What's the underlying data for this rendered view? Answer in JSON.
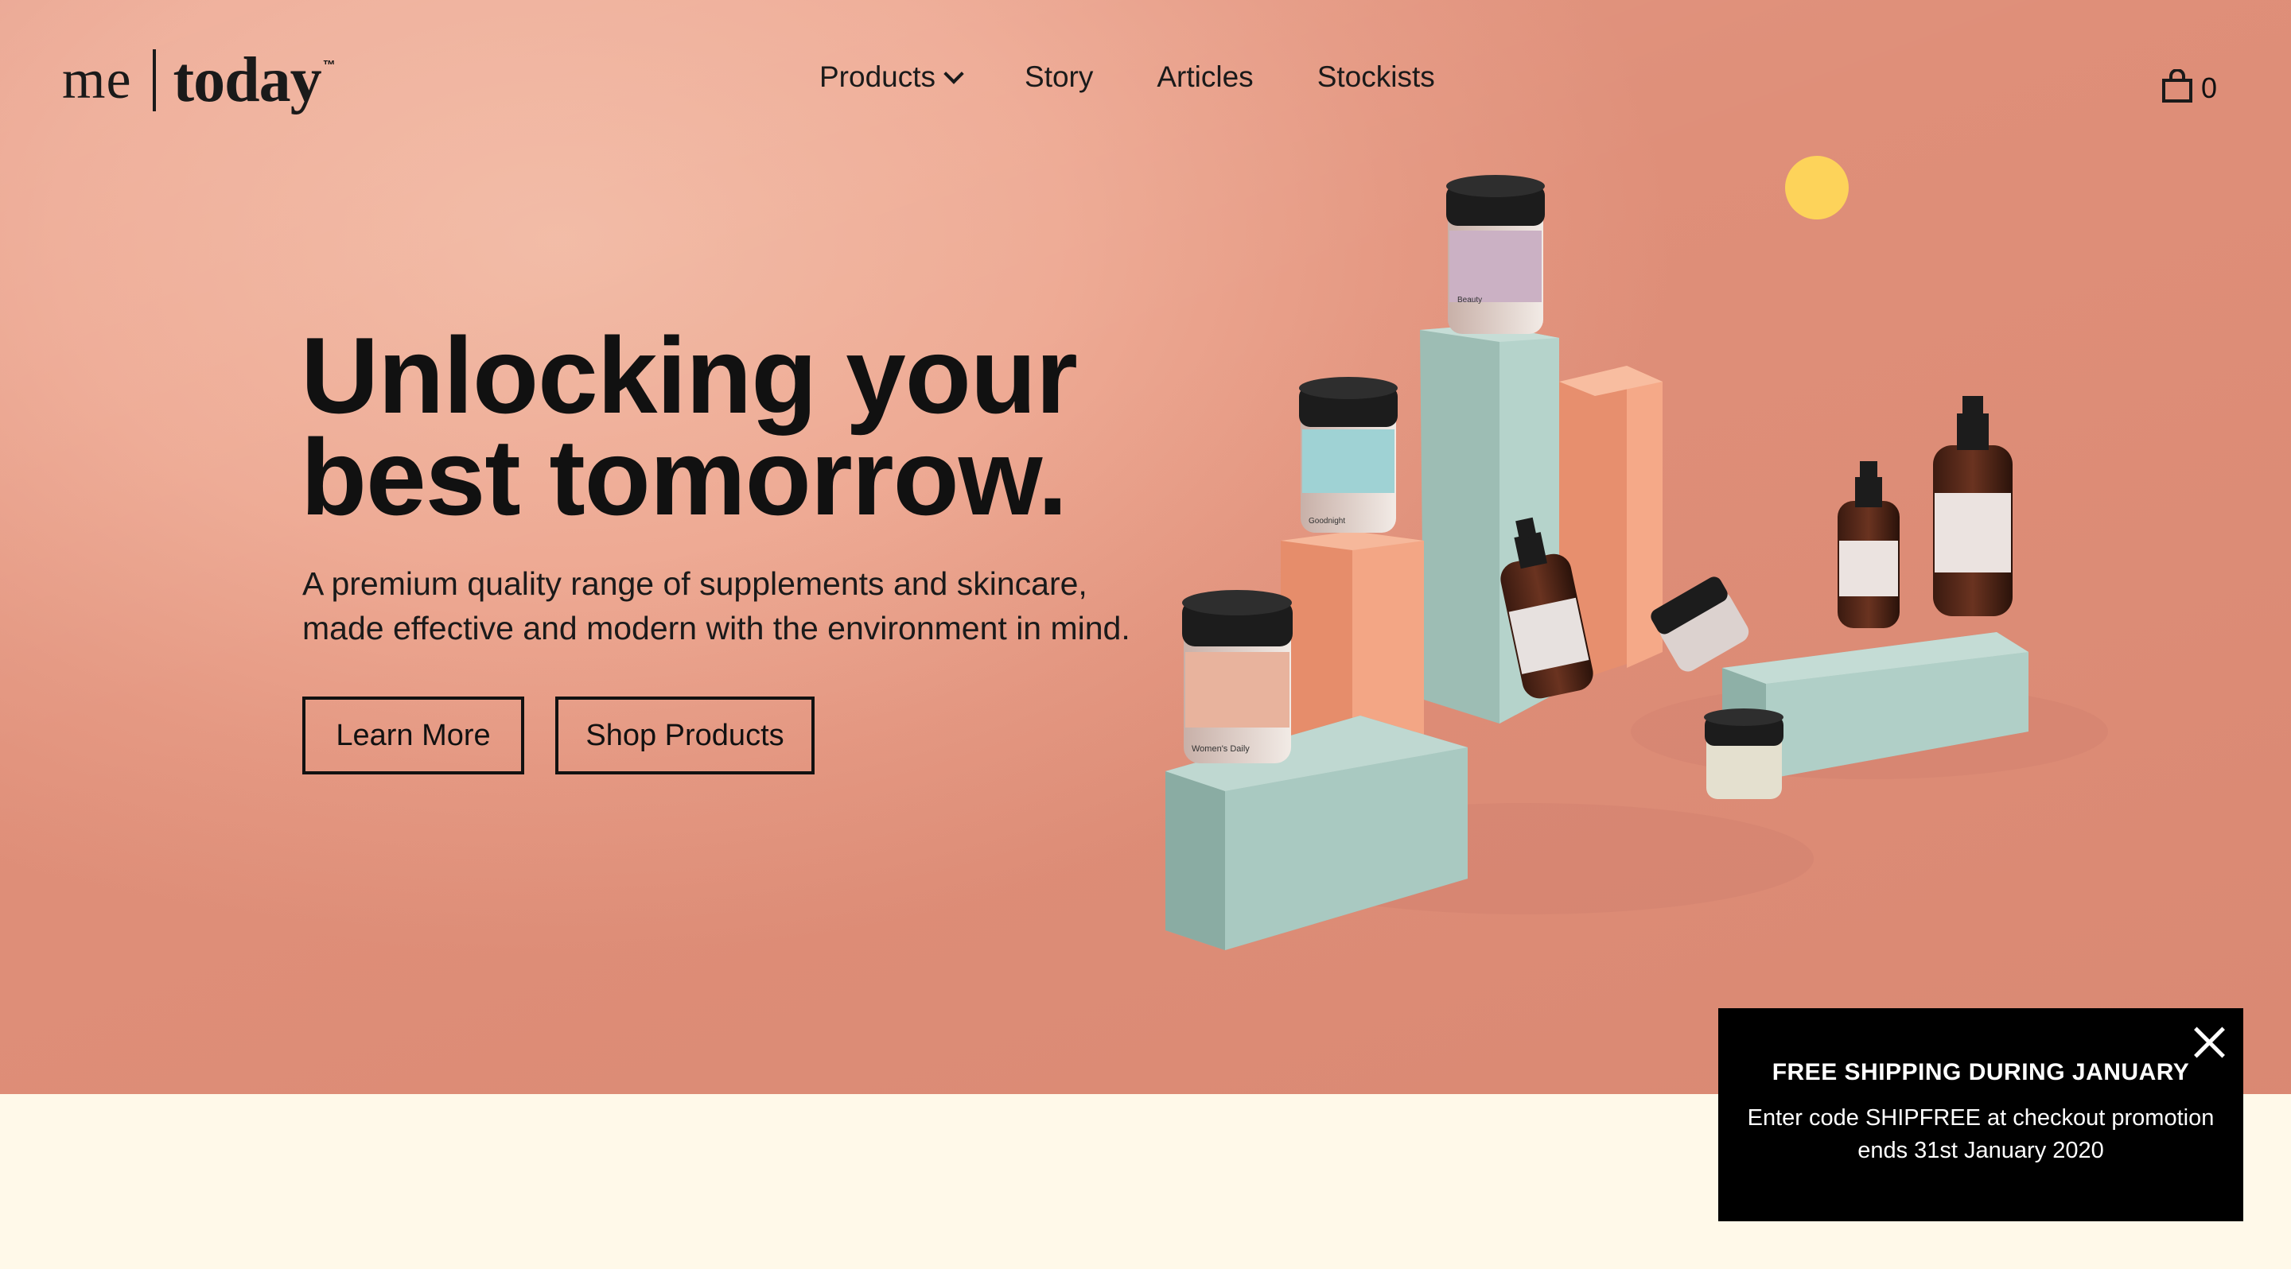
{
  "brand": {
    "me": "me",
    "today": "today",
    "tm": "™"
  },
  "nav": {
    "items": [
      {
        "label": "Products",
        "has_dropdown": true
      },
      {
        "label": "Story"
      },
      {
        "label": "Articles"
      },
      {
        "label": "Stockists"
      }
    ]
  },
  "cart": {
    "icon": "shopping-bag-icon",
    "count": "0"
  },
  "hero": {
    "headline_line1": "Unlocking your",
    "headline_line2": "best tomorrow.",
    "subtitle_line1": "A premium quality range of supplements and skincare,",
    "subtitle_line2": "made effective and modern with the environment in mind.",
    "learn_more_label": "Learn More",
    "shop_products_label": "Shop Products"
  },
  "products": {
    "labels": [
      "Beauty",
      "Goodnight",
      "Women's Daily"
    ]
  },
  "promo": {
    "title": "FREE SHIPPING DURING JANUARY",
    "message": "Enter code SHIPFREE at checkout promotion ends 31st January 2020",
    "close_icon": "close-icon"
  },
  "colors": {
    "hero_background": "#eeaa94",
    "page_background": "#fff9e9",
    "mint_block": "#a9c9c1",
    "peach_block": "#f1a07f",
    "sun": "#fdd35a",
    "promo_background": "#000000"
  }
}
